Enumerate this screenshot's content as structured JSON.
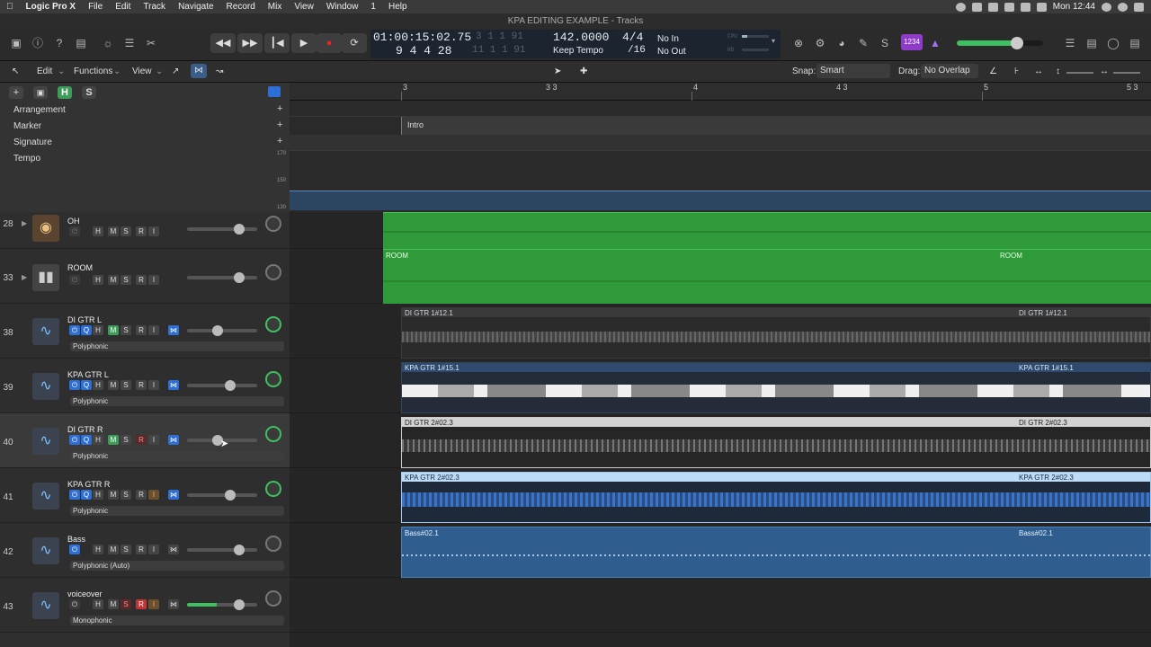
{
  "menubar": {
    "items": [
      "Logic Pro X",
      "File",
      "Edit",
      "Track",
      "Navigate",
      "Record",
      "Mix",
      "View",
      "Window",
      "1",
      "Help"
    ],
    "clock": "Mon 12:44"
  },
  "window": {
    "title": "KPA EDITING EXAMPLE - Tracks"
  },
  "lcd": {
    "time": "01:00:15:02.75",
    "bars_top": "3  1  1  91",
    "bars_main": "9  4  4  28",
    "bars_bottom": "11  1  1  91",
    "tempo": "142.0000",
    "tempo_mode": "Keep Tempo",
    "sig_top": "4/4",
    "sig_bottom": "/16",
    "in": "No In",
    "out": "No Out",
    "cpu": "CPU",
    "hd": "HD",
    "key": "1234"
  },
  "edit_toolbar": {
    "edit": "Edit",
    "functions": "Functions",
    "view": "View",
    "snap_label": "Snap:",
    "snap_value": "Smart",
    "drag_label": "Drag:",
    "drag_value": "No Overlap"
  },
  "ruler": {
    "marks": [
      "3",
      "3 3",
      "4",
      "4 3",
      "5",
      "5 3"
    ]
  },
  "global_tracks": [
    {
      "label": "Arrangement"
    },
    {
      "label": "Marker"
    },
    {
      "label": "Signature"
    },
    {
      "label": "Tempo"
    }
  ],
  "arrangement_marker": "Intro",
  "tempo_scale": [
    "170",
    "150",
    "130"
  ],
  "tracks": [
    {
      "num": "28",
      "name": "OH",
      "icon": "cymbal-icon",
      "mode": "",
      "fader": 0.75,
      "selected": false
    },
    {
      "num": "33",
      "name": "ROOM",
      "icon": "mic-icon",
      "mode": "",
      "fader": 0.75,
      "selected": false
    },
    {
      "num": "38",
      "name": "DI GTR L",
      "icon": "waveform-icon",
      "mode": "Polyphonic",
      "fader": 0.45,
      "selected": false
    },
    {
      "num": "39",
      "name": "KPA GTR L",
      "icon": "waveform-icon",
      "mode": "Polyphonic",
      "fader": 0.62,
      "selected": false
    },
    {
      "num": "40",
      "name": "DI GTR R",
      "icon": "waveform-icon",
      "mode": "Polyphonic",
      "fader": 0.45,
      "selected": true
    },
    {
      "num": "41",
      "name": "KPA GTR R",
      "icon": "waveform-icon",
      "mode": "Polyphonic",
      "fader": 0.62,
      "selected": false
    },
    {
      "num": "42",
      "name": "Bass",
      "icon": "waveform-icon",
      "mode": "Polyphonic (Auto)",
      "fader": 0.75,
      "selected": false
    },
    {
      "num": "43",
      "name": "voiceover",
      "icon": "waveform-icon",
      "mode": "Monophonic",
      "fader": 0.75,
      "selected": false
    }
  ],
  "regions": {
    "oh": "",
    "room_a": "ROOM",
    "room_b": "ROOM",
    "di_l_a": "DI GTR 1#12.1",
    "di_l_b": "DI GTR 1#12.1",
    "kpa_l_a": "KPA GTR 1#15.1",
    "kpa_l_b": "KPA GTR 1#15.1",
    "di_r_a": "DI GTR 2#02.3",
    "di_r_b": "DI GTR 2#02.3",
    "kpa_r_a": "KPA GTR 2#02.3",
    "kpa_r_b": "KPA GTR 2#02.3",
    "bass_a": "Bass#02.1",
    "bass_b": "Bass#02.1"
  },
  "colors": {
    "green_region": "#2f9a3a",
    "blue_region": "#2e5d8e",
    "selected_header": "#3a3a3a"
  }
}
